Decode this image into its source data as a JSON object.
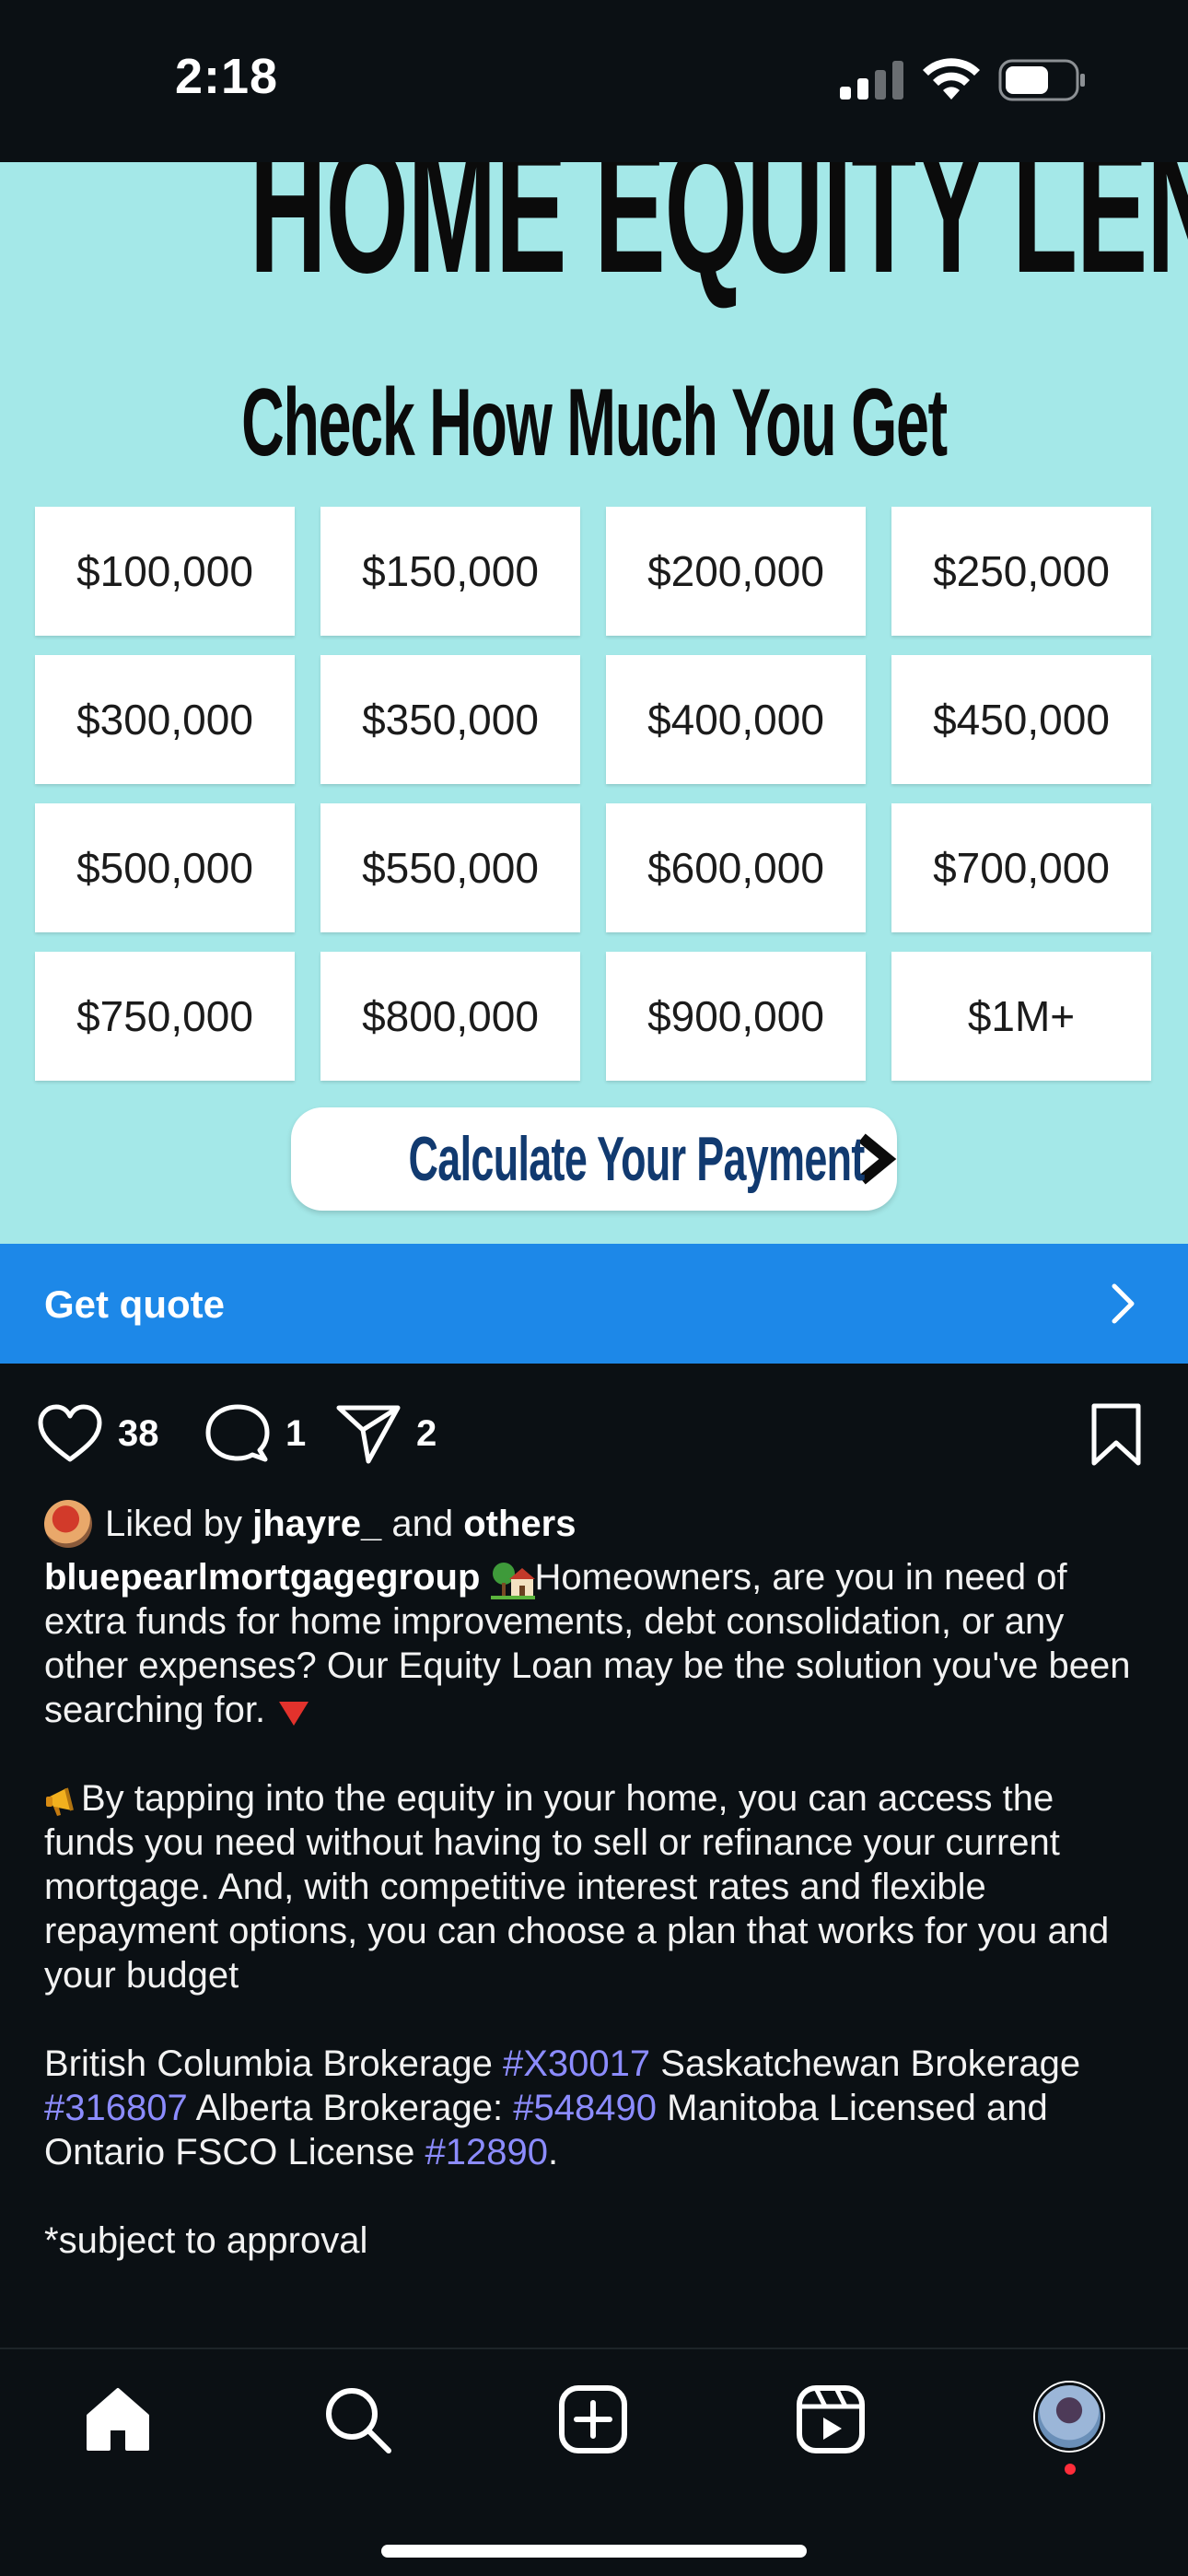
{
  "status_bar": {
    "time": "2:18"
  },
  "ad": {
    "headline": "HOME EQUITY LENDING",
    "subhead": "Check How Much You Get",
    "amounts": [
      "$100,000",
      "$150,000",
      "$200,000",
      "$250,000",
      "$300,000",
      "$350,000",
      "$400,000",
      "$450,000",
      "$500,000",
      "$550,000",
      "$600,000",
      "$700,000",
      "$750,000",
      "$800,000",
      "$900,000",
      "$1M+"
    ],
    "cta_label": "Calculate Your Payment",
    "background_color": "#a4e8e8",
    "cta_text_color": "#113a70"
  },
  "quote_bar": {
    "label": "Get quote",
    "color": "#1d88e8"
  },
  "actions": {
    "likes": "38",
    "comments": "1",
    "shares": "2"
  },
  "caption": {
    "liked_by_prefix": "Liked by",
    "liked_by_user": "jhayre_",
    "liked_by_and": "and",
    "liked_by_others": "others",
    "username": "bluepearlmortgagegroup",
    "p1": "Homeowners, are you in need of extra funds for home improvements, debt consolidation, or any other expenses? Our Equity Loan may be the solution you've been searching for.",
    "p2": "By tapping into the equity in your home, you can access the funds you need without having to sell or refinance your current mortgage. And, with competitive interest rates and flexible repayment options, you can choose a plan that works for you and your budget",
    "license_1": "British Columbia Brokerage",
    "tag_1": "#X30017",
    "license_2": "Saskatchewan Brokerage",
    "tag_2": "#316807",
    "license_3": "Alberta Brokerage:",
    "tag_3": "#548490",
    "license_4": "Manitoba Licensed and Ontario FSCO License",
    "tag_4": "#12890",
    "license_end": ".",
    "disclaimer": "*subject to approval"
  },
  "colors": {
    "app_background": "#0b1014",
    "hashtag": "#8c8cff",
    "notification_dot": "#ff2d3a"
  },
  "nav": {
    "icons": [
      "home-icon",
      "search-icon",
      "create-icon",
      "reels-icon",
      "profile-avatar"
    ]
  }
}
